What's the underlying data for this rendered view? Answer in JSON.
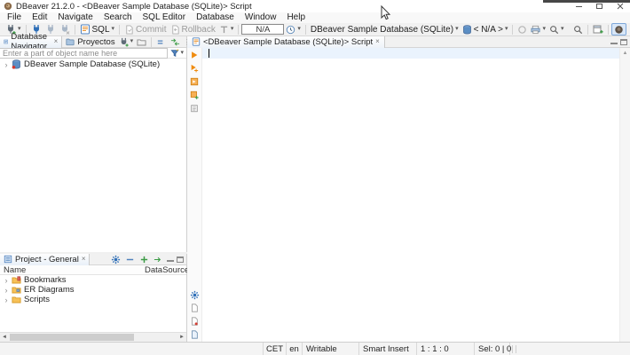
{
  "window": {
    "title": "DBeaver 21.2.0 - <DBeaver Sample Database (SQLite)> Script"
  },
  "menu": [
    "File",
    "Edit",
    "Navigate",
    "Search",
    "SQL Editor",
    "Database",
    "Window",
    "Help"
  ],
  "toolbar": {
    "sql": "SQL",
    "commit": "Commit",
    "rollback": "Rollback",
    "txn_value": "N/A",
    "connection": "DBeaver Sample Database (SQLite)",
    "schema": "< N/A >"
  },
  "icons": {
    "dropdown": "▾",
    "tab_close": "×",
    "overflow": "⋮",
    "tree_chevron": "›",
    "scroll_up": "▲",
    "scroll_left": "◄",
    "scroll_right": "►"
  },
  "navigator": {
    "tab_primary": "Database Navigator",
    "tab_secondary": "Proyectos",
    "filter_placeholder": "Enter a part of object name here",
    "tree_items": [
      {
        "label": "DBeaver Sample Database (SQLite)"
      }
    ]
  },
  "project_panel": {
    "tab": "Project - General",
    "columns": {
      "name": "Name",
      "datasource": "DataSource"
    },
    "items": [
      {
        "label": "Bookmarks"
      },
      {
        "label": "ER Diagrams"
      },
      {
        "label": "Scripts"
      }
    ]
  },
  "editor": {
    "tab": "<DBeaver Sample Database (SQLite)> Script"
  },
  "statusbar": {
    "timezone": "CET",
    "language": "en",
    "write_mode": "Writable",
    "insert_mode": "Smart Insert",
    "caret_position": "1 : 1 : 0",
    "selection": "Sel: 0 | 0"
  }
}
